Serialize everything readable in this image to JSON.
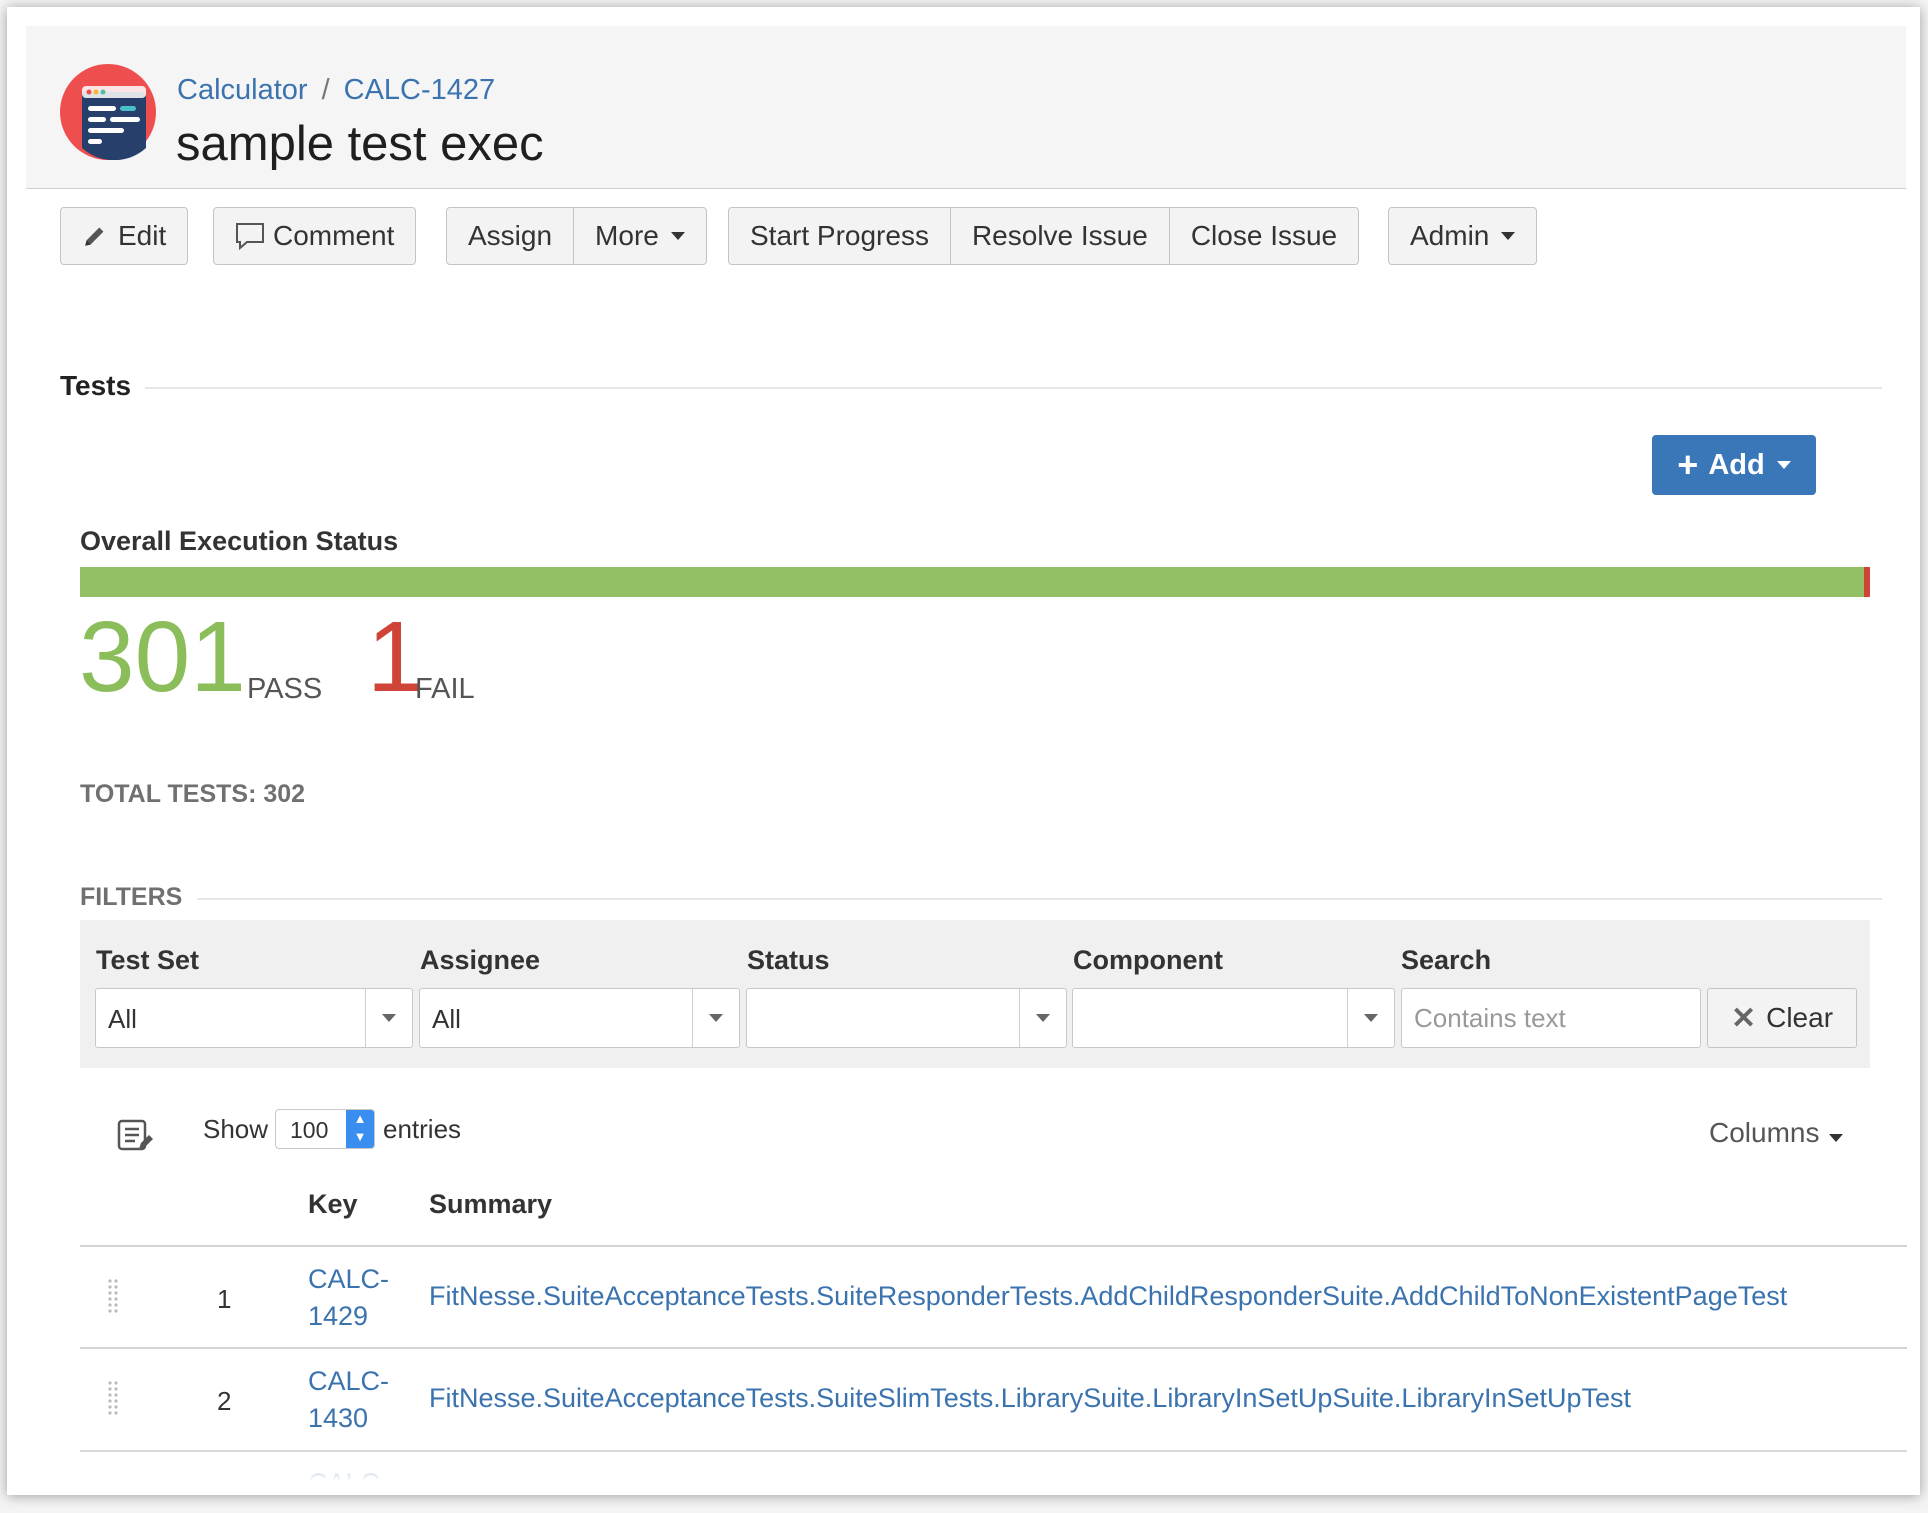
{
  "breadcrumb": {
    "project": "Calculator",
    "separator": "/",
    "issue_key": "CALC-1427"
  },
  "issue_title": "sample test exec",
  "toolbar": {
    "edit": "Edit",
    "comment": "Comment",
    "assign": "Assign",
    "more": "More",
    "start_progress": "Start Progress",
    "resolve_issue": "Resolve Issue",
    "close_issue": "Close Issue",
    "admin": "Admin"
  },
  "tests_section": {
    "title": "Tests",
    "add_label": "Add"
  },
  "execution_status": {
    "title": "Overall Execution Status",
    "pass_count": "301",
    "pass_label": "PASS",
    "fail_count": "1",
    "fail_label": "FAIL",
    "pass_fraction": 0.9967,
    "fail_fraction": 0.0033,
    "total_label": "TOTAL TESTS: 302",
    "colors": {
      "pass": "#93c064",
      "fail": "#d04437"
    }
  },
  "filters": {
    "title": "FILTERS",
    "test_set": {
      "label": "Test Set",
      "value": "All"
    },
    "assignee": {
      "label": "Assignee",
      "value": "All"
    },
    "status": {
      "label": "Status",
      "value": ""
    },
    "component": {
      "label": "Component",
      "value": ""
    },
    "search": {
      "label": "Search",
      "placeholder": "Contains text",
      "value": ""
    },
    "clear_label": "Clear"
  },
  "table": {
    "show_label": "Show",
    "entries_value": "100",
    "entries_label": "entries",
    "columns_label": "Columns",
    "headers": {
      "key": "Key",
      "summary": "Summary"
    },
    "rows": [
      {
        "num": "1",
        "key": "CALC-1429",
        "summary": "FitNesse.SuiteAcceptanceTests.SuiteResponderTests.AddChildResponderSuite.AddChildToNonExistentPageTest"
      },
      {
        "num": "2",
        "key": "CALC-1430",
        "summary": "FitNesse.SuiteAcceptanceTests.SuiteSlimTests.LibrarySuite.LibraryInSetUpSuite.LibraryInSetUpTest"
      },
      {
        "key": "CALC-"
      }
    ]
  },
  "colors": {
    "accent": "#3a77b8",
    "link": "#3b73af",
    "header_bg": "#f5f5f5"
  }
}
